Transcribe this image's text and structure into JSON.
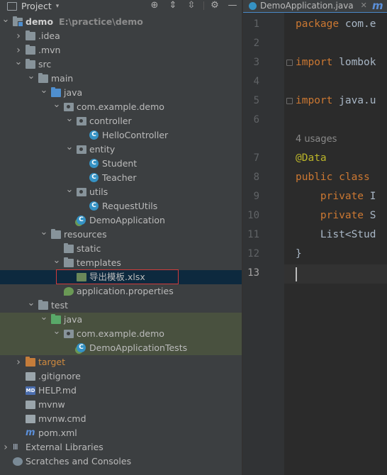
{
  "panel": {
    "title": "Project",
    "buttons": [
      "crosshair-icon",
      "expand-all-icon",
      "collapse-all-icon",
      "gear-icon",
      "minimize-icon"
    ]
  },
  "tree": [
    {
      "indent": 0,
      "arrow": "down",
      "icon": "module-folder",
      "label": "demo",
      "extra": "E:\\practice\\demo",
      "bold": true
    },
    {
      "indent": 1,
      "arrow": "right",
      "icon": "folder",
      "label": ".idea"
    },
    {
      "indent": 1,
      "arrow": "right",
      "icon": "folder",
      "label": ".mvn"
    },
    {
      "indent": 1,
      "arrow": "down",
      "icon": "folder",
      "label": "src"
    },
    {
      "indent": 2,
      "arrow": "down",
      "icon": "folder",
      "label": "main"
    },
    {
      "indent": 3,
      "arrow": "down",
      "icon": "folder-blue",
      "label": "java"
    },
    {
      "indent": 4,
      "arrow": "down",
      "icon": "package",
      "label": "com.example.demo"
    },
    {
      "indent": 5,
      "arrow": "down",
      "icon": "package",
      "label": "controller"
    },
    {
      "indent": 6,
      "arrow": "none",
      "icon": "class",
      "label": "HelloController"
    },
    {
      "indent": 5,
      "arrow": "down",
      "icon": "package",
      "label": "entity"
    },
    {
      "indent": 6,
      "arrow": "none",
      "icon": "class",
      "label": "Student"
    },
    {
      "indent": 6,
      "arrow": "none",
      "icon": "class",
      "label": "Teacher"
    },
    {
      "indent": 5,
      "arrow": "down",
      "icon": "package",
      "label": "utils"
    },
    {
      "indent": 6,
      "arrow": "none",
      "icon": "class",
      "label": "RequestUtils"
    },
    {
      "indent": 5,
      "arrow": "none",
      "icon": "spring-class",
      "label": "DemoApplication"
    },
    {
      "indent": 3,
      "arrow": "down",
      "icon": "resources-folder",
      "label": "resources"
    },
    {
      "indent": 4,
      "arrow": "none",
      "icon": "folder",
      "label": "static"
    },
    {
      "indent": 4,
      "arrow": "down",
      "icon": "folder",
      "label": "templates"
    },
    {
      "indent": 5,
      "arrow": "none",
      "icon": "excel-file",
      "label": "导出模板.xlsx",
      "selected": true
    },
    {
      "indent": 4,
      "arrow": "none",
      "icon": "spring-properties",
      "label": "application.properties"
    },
    {
      "indent": 2,
      "arrow": "down",
      "icon": "folder",
      "label": "test"
    },
    {
      "indent": 3,
      "arrow": "down",
      "icon": "folder-green",
      "label": "java",
      "test": true
    },
    {
      "indent": 4,
      "arrow": "down",
      "icon": "package",
      "label": "com.example.demo",
      "test": true
    },
    {
      "indent": 5,
      "arrow": "none",
      "icon": "spring-class",
      "label": "DemoApplicationTests",
      "test": true
    },
    {
      "indent": 1,
      "arrow": "right",
      "icon": "folder-orange",
      "label": "target"
    },
    {
      "indent": 1,
      "arrow": "none",
      "icon": "gitignore-file",
      "label": ".gitignore"
    },
    {
      "indent": 1,
      "arrow": "none",
      "icon": "md-file",
      "label": "HELP.md"
    },
    {
      "indent": 1,
      "arrow": "none",
      "icon": "text-file",
      "label": "mvnw"
    },
    {
      "indent": 1,
      "arrow": "none",
      "icon": "text-file",
      "label": "mvnw.cmd"
    },
    {
      "indent": 1,
      "arrow": "none",
      "icon": "maven-file",
      "label": "pom.xml"
    },
    {
      "indent": 0,
      "arrow": "right",
      "icon": "library",
      "label": "External Libraries"
    },
    {
      "indent": 0,
      "arrow": "none",
      "icon": "scratches",
      "label": "Scratches and Consoles"
    }
  ],
  "editor": {
    "tab_label": "DemoApplication.java",
    "tab_close": "✕",
    "next_tab_glyph": "m",
    "usages": "4 usages",
    "lines": [
      {
        "n": "1",
        "code": [
          {
            "t": "package ",
            "c": "kw"
          },
          {
            "t": "com.e",
            "c": ""
          }
        ]
      },
      {
        "n": "2",
        "code": []
      },
      {
        "n": "3",
        "code": [
          {
            "t": "import ",
            "c": "kw"
          },
          {
            "t": "lombok",
            "c": ""
          }
        ],
        "fold": true
      },
      {
        "n": "4",
        "code": []
      },
      {
        "n": "5",
        "code": [
          {
            "t": "import ",
            "c": "kw"
          },
          {
            "t": "java.u",
            "c": ""
          }
        ],
        "fold": true
      },
      {
        "n": "6",
        "code": []
      },
      {
        "n": "7",
        "code": [
          {
            "t": "@Data",
            "c": "an"
          }
        ]
      },
      {
        "n": "8",
        "code": [
          {
            "t": "public class ",
            "c": "kw"
          }
        ]
      },
      {
        "n": "9",
        "code": [
          {
            "t": "    private ",
            "c": "kw"
          },
          {
            "t": "I",
            "c": ""
          }
        ]
      },
      {
        "n": "10",
        "code": [
          {
            "t": "    private ",
            "c": "kw"
          },
          {
            "t": "S",
            "c": ""
          }
        ]
      },
      {
        "n": "11",
        "code": [
          {
            "t": "    List<Stud",
            "c": ""
          }
        ]
      },
      {
        "n": "12",
        "code": [
          {
            "t": "}",
            "c": ""
          }
        ]
      },
      {
        "n": "13",
        "code": [],
        "current": true
      }
    ]
  }
}
